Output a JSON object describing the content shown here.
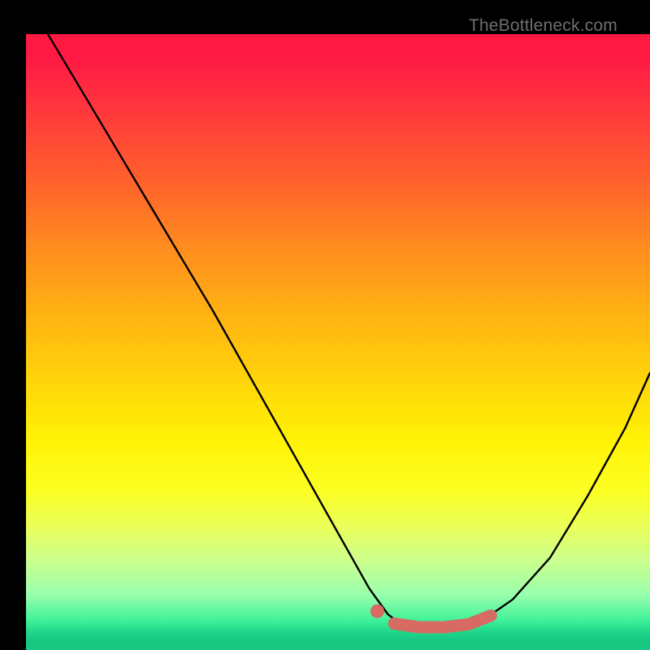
{
  "watermark": "TheBottleneck.com",
  "colors": {
    "page_bg": "#000000",
    "curve": "#000000",
    "marker": "#d76b63",
    "gradient_top": "#ff1a44",
    "gradient_mid": "#fff205",
    "gradient_bottom": "#18c782"
  },
  "chart_data": {
    "type": "line",
    "title": "",
    "xlabel": "",
    "ylabel": "",
    "xlim": [
      0,
      100
    ],
    "ylim": [
      0,
      100
    ],
    "series": [
      {
        "name": "bottleneck-curve-left",
        "_comment": "Left descending branch of the V curve. x in 0..100 domain, y in 0..100 (0 bottom / 100 top).",
        "points": [
          {
            "x": 3.5,
            "y": 100
          },
          {
            "x": 10,
            "y": 89
          },
          {
            "x": 20,
            "y": 72
          },
          {
            "x": 30,
            "y": 55
          },
          {
            "x": 40,
            "y": 37
          },
          {
            "x": 50,
            "y": 19
          },
          {
            "x": 55,
            "y": 10
          },
          {
            "x": 58,
            "y": 5.8
          },
          {
            "x": 60,
            "y": 4.2
          },
          {
            "x": 62,
            "y": 3.8
          }
        ]
      },
      {
        "name": "bottleneck-curve-right",
        "_comment": "Right ascending branch.",
        "points": [
          {
            "x": 62,
            "y": 3.8
          },
          {
            "x": 66,
            "y": 3.6
          },
          {
            "x": 70,
            "y": 4.0
          },
          {
            "x": 74,
            "y": 5.4
          },
          {
            "x": 78,
            "y": 8.2
          },
          {
            "x": 84,
            "y": 15
          },
          {
            "x": 90,
            "y": 25
          },
          {
            "x": 96,
            "y": 36
          },
          {
            "x": 100,
            "y": 45
          }
        ]
      },
      {
        "name": "highlight-valley",
        "_comment": "Thick salmon marker segment tracing the valley bottom.",
        "points": [
          {
            "x": 59,
            "y": 4.3
          },
          {
            "x": 63,
            "y": 3.7
          },
          {
            "x": 67,
            "y": 3.7
          },
          {
            "x": 71,
            "y": 4.2
          },
          {
            "x": 74.5,
            "y": 5.6
          }
        ]
      }
    ],
    "markers": [
      {
        "name": "highlight-dot",
        "x": 56.3,
        "y": 6.3
      }
    ]
  }
}
